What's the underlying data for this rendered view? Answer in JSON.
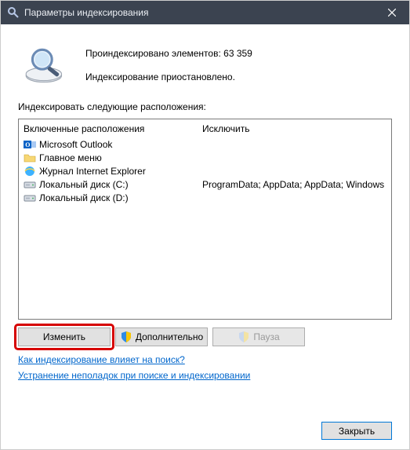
{
  "titlebar": {
    "title": "Параметры индексирования"
  },
  "header": {
    "line1_prefix": "Проиндексировано элементов: ",
    "count": "63 359",
    "line2": "Индексирование приостановлено."
  },
  "section_label": "Индексировать следующие расположения:",
  "columns": {
    "included": "Включенные расположения",
    "excluded": "Исключить"
  },
  "included_items": [
    {
      "icon": "outlook",
      "label": "Microsoft Outlook"
    },
    {
      "icon": "folder",
      "label": "Главное меню"
    },
    {
      "icon": "ie",
      "label": "Журнал Internet Explorer"
    },
    {
      "icon": "drive",
      "label": "Локальный диск (C:)"
    },
    {
      "icon": "drive",
      "label": "Локальный диск (D:)"
    }
  ],
  "excluded_items": [
    "",
    "",
    "",
    "ProgramData; AppData; AppData; Windows",
    ""
  ],
  "buttons": {
    "modify": "Изменить",
    "advanced": "Дополнительно",
    "pause": "Пауза",
    "close": "Закрыть"
  },
  "links": {
    "l1": "Как индексирование влияет на поиск?",
    "l2": "Устранение неполадок при поиске и индексировании"
  }
}
